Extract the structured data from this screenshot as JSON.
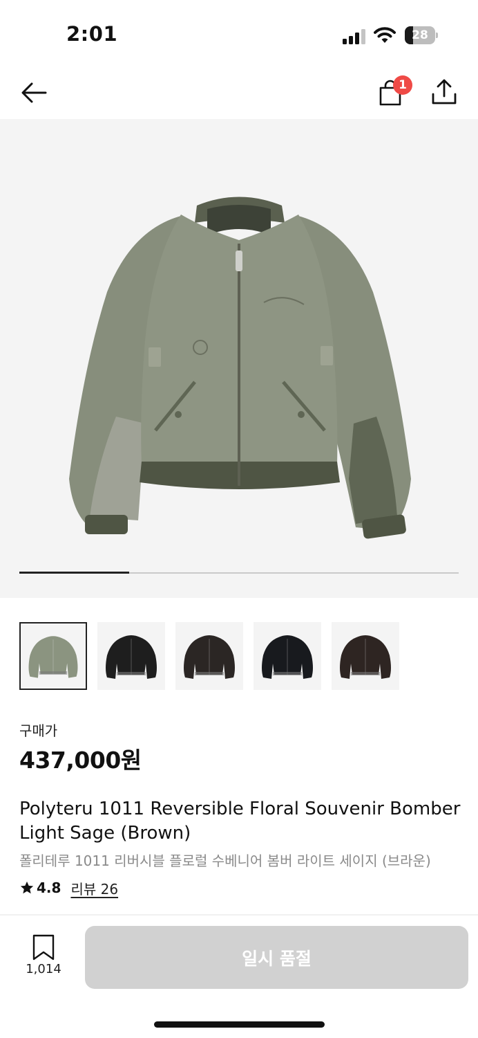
{
  "status_bar": {
    "time": "2:01",
    "battery": "28",
    "battery_level": 0.28,
    "icons": [
      "signal-icon",
      "wifi-icon",
      "battery-icon"
    ]
  },
  "nav": {
    "back_icon": "arrow-left-icon",
    "cart_icon": "shopping-bag-icon",
    "cart_badge": "1",
    "share_icon": "share-icon",
    "badge_color": "#ef4a46"
  },
  "gallery": {
    "image_description_icon": "jacket-image",
    "progress": 0.25,
    "thumbnails": [
      {
        "color": "#8b9480",
        "active": true
      },
      {
        "color": "#1e1e1e",
        "active": false
      },
      {
        "color": "#2b2624",
        "active": false
      },
      {
        "color": "#181a1e",
        "active": false
      },
      {
        "color": "#2e2522",
        "active": false
      }
    ]
  },
  "product": {
    "price_label": "구매가",
    "price": "437,000원",
    "title": "Polyteru 1011 Reversible Floral Souvenir Bomber Light Sage (Brown)",
    "subtitle": "폴리테루 1011 리버시블 플로럴 수베니어 봄버 라이트 세이지 (브라운)",
    "rating": "4.8",
    "reviews": "리뷰 26"
  },
  "bottom_bar": {
    "bookmark_count": "1,014",
    "soldout_label": "일시 품절",
    "button_color": "#d1d1d1"
  }
}
